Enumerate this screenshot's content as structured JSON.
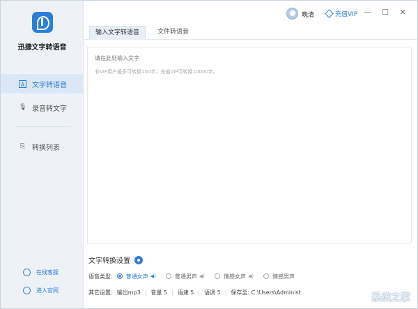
{
  "app": {
    "title": "迅捷文字转语音"
  },
  "sidebar": {
    "items": [
      {
        "label": "文字转语音",
        "icon": "text-a-icon",
        "active": true
      },
      {
        "label": "录音转文字",
        "icon": "microphone-icon",
        "active": false
      },
      {
        "label": "转换列表",
        "icon": "file-convert-icon",
        "active": false
      }
    ],
    "bottom_links": [
      {
        "label": "在线客服",
        "icon": "headset-icon"
      },
      {
        "label": "进入官网",
        "icon": "globe-icon"
      }
    ]
  },
  "titlebar": {
    "username": "晚清",
    "vip_label": "充值VIP",
    "minimize": "—",
    "maximize": "☐",
    "close": "✕"
  },
  "tabs": [
    {
      "label": "输入文字转语音",
      "active": true
    },
    {
      "label": "文件转语音",
      "active": false
    }
  ],
  "editor": {
    "placeholder": "请在此处输入文字",
    "hint": "非VIP用户最多可转换100字，充值VIP可转换10000字。"
  },
  "settings": {
    "title": "文字转换设置",
    "voice_label": "语音类型:",
    "voices": [
      {
        "label": "普通女声",
        "selected": true
      },
      {
        "label": "普通男声",
        "selected": false
      },
      {
        "label": "情感女声",
        "selected": false
      },
      {
        "label": "情感男声",
        "selected": false
      }
    ],
    "other_label": "其它设置:",
    "other": [
      "输出mp3",
      "音量 5",
      "语速 5",
      "语调 5",
      "保存至: C:\\Users\\Administ"
    ]
  },
  "watermark": "系统之家",
  "colors": {
    "accent": "#2f7bd3",
    "sidebar_bg": "#eef2f7"
  }
}
